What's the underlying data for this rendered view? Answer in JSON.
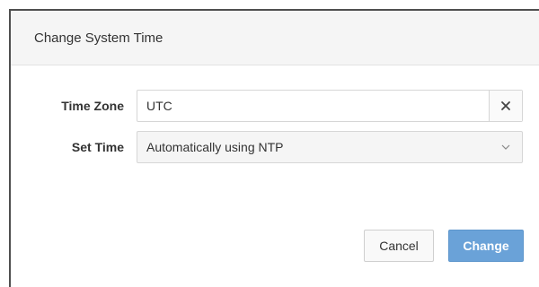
{
  "dialog": {
    "title": "Change System Time"
  },
  "form": {
    "time_zone": {
      "label": "Time Zone",
      "value": "UTC",
      "clear_icon": "close-icon"
    },
    "set_time": {
      "label": "Set Time",
      "selected": "Automatically using NTP",
      "dropdown_icon": "chevron-down-icon"
    }
  },
  "buttons": {
    "cancel": "Cancel",
    "change": "Change"
  },
  "colors": {
    "primary": "#6aa2d8",
    "header_bg": "#f5f5f5",
    "border": "#d6d6d6"
  }
}
